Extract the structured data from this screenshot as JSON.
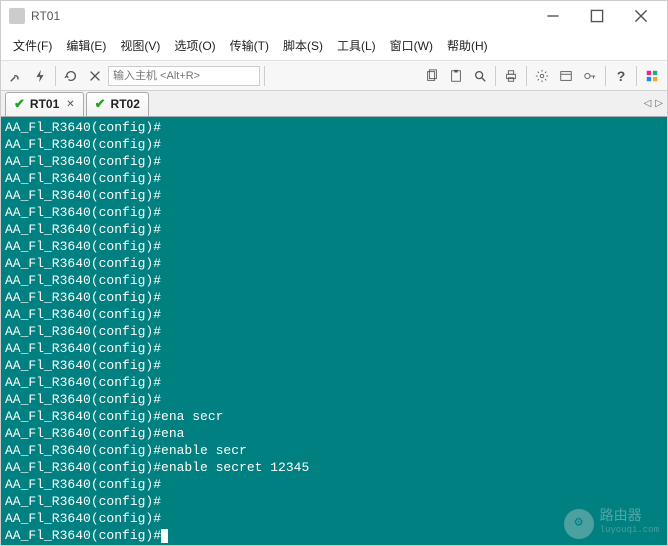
{
  "window": {
    "title": "RT01"
  },
  "menubar": {
    "items": [
      {
        "label": "文件(F)"
      },
      {
        "label": "编辑(E)"
      },
      {
        "label": "视图(V)"
      },
      {
        "label": "选项(O)"
      },
      {
        "label": "传输(T)"
      },
      {
        "label": "脚本(S)"
      },
      {
        "label": "工具(L)"
      },
      {
        "label": "窗口(W)"
      },
      {
        "label": "帮助(H)"
      }
    ]
  },
  "toolbar": {
    "host_placeholder": "输入主机 <Alt+R>"
  },
  "tabs": {
    "items": [
      {
        "label": "RT01",
        "active": true
      },
      {
        "label": "RT02",
        "active": false
      }
    ]
  },
  "terminal": {
    "prompt": "AA_Fl_R3640(config)#",
    "lines": [
      "AA_Fl_R3640(config)#",
      "AA_Fl_R3640(config)#",
      "AA_Fl_R3640(config)#",
      "AA_Fl_R3640(config)#",
      "AA_Fl_R3640(config)#",
      "AA_Fl_R3640(config)#",
      "AA_Fl_R3640(config)#",
      "AA_Fl_R3640(config)#",
      "AA_Fl_R3640(config)#",
      "AA_Fl_R3640(config)#",
      "AA_Fl_R3640(config)#",
      "AA_Fl_R3640(config)#",
      "AA_Fl_R3640(config)#",
      "AA_Fl_R3640(config)#",
      "AA_Fl_R3640(config)#",
      "AA_Fl_R3640(config)#",
      "AA_Fl_R3640(config)#",
      "AA_Fl_R3640(config)#ena secr",
      "AA_Fl_R3640(config)#ena",
      "AA_Fl_R3640(config)#enable secr",
      "AA_Fl_R3640(config)#enable secret 12345",
      "AA_Fl_R3640(config)#",
      "AA_Fl_R3640(config)#",
      "AA_Fl_R3640(config)#",
      "AA_Fl_R3640(config)#"
    ]
  },
  "watermark": {
    "brand": "路由器",
    "url": "luyouqi.com"
  }
}
